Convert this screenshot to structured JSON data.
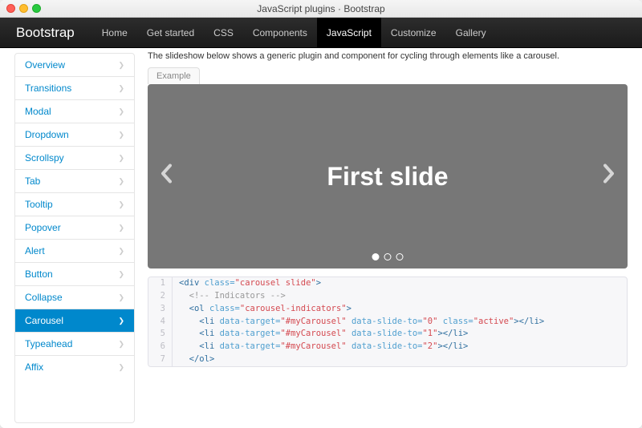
{
  "window": {
    "title": "JavaScript plugins · Bootstrap"
  },
  "navbar": {
    "brand": "Bootstrap",
    "items": [
      "Home",
      "Get started",
      "CSS",
      "Components",
      "JavaScript",
      "Customize",
      "Gallery"
    ],
    "active_index": 4
  },
  "sidebar": {
    "items": [
      "Overview",
      "Transitions",
      "Modal",
      "Dropdown",
      "Scrollspy",
      "Tab",
      "Tooltip",
      "Popover",
      "Alert",
      "Button",
      "Collapse",
      "Carousel",
      "Typeahead",
      "Affix"
    ],
    "active_index": 11
  },
  "main": {
    "description": "The slideshow below shows a generic plugin and component for cycling through elements like a carousel.",
    "example_label": "Example",
    "slide_text": "First slide",
    "indicator_count": 3,
    "indicator_active": 0
  },
  "code": {
    "lines": [
      {
        "n": "1",
        "html": "<span class='tag'>&lt;div</span> <span class='attr'>class=</span><span class='val'>\"carousel slide\"</span><span class='tag'>&gt;</span>"
      },
      {
        "n": "2",
        "html": "  <span class='cmt'>&lt;!-- Indicators --&gt;</span>"
      },
      {
        "n": "3",
        "html": "  <span class='tag'>&lt;ol</span> <span class='attr'>class=</span><span class='val'>\"carousel-indicators\"</span><span class='tag'>&gt;</span>"
      },
      {
        "n": "4",
        "html": "    <span class='tag'>&lt;li</span> <span class='attr'>data-target=</span><span class='val'>\"#myCarousel\"</span> <span class='attr'>data-slide-to=</span><span class='val'>\"0\"</span> <span class='attr'>class=</span><span class='val'>\"active\"</span><span class='tag'>&gt;&lt;/li&gt;</span>"
      },
      {
        "n": "5",
        "html": "    <span class='tag'>&lt;li</span> <span class='attr'>data-target=</span><span class='val'>\"#myCarousel\"</span> <span class='attr'>data-slide-to=</span><span class='val'>\"1\"</span><span class='tag'>&gt;&lt;/li&gt;</span>"
      },
      {
        "n": "6",
        "html": "    <span class='tag'>&lt;li</span> <span class='attr'>data-target=</span><span class='val'>\"#myCarousel\"</span> <span class='attr'>data-slide-to=</span><span class='val'>\"2\"</span><span class='tag'>&gt;&lt;/li&gt;</span>"
      },
      {
        "n": "7",
        "html": "  <span class='tag'>&lt;/ol&gt;</span>"
      }
    ]
  }
}
